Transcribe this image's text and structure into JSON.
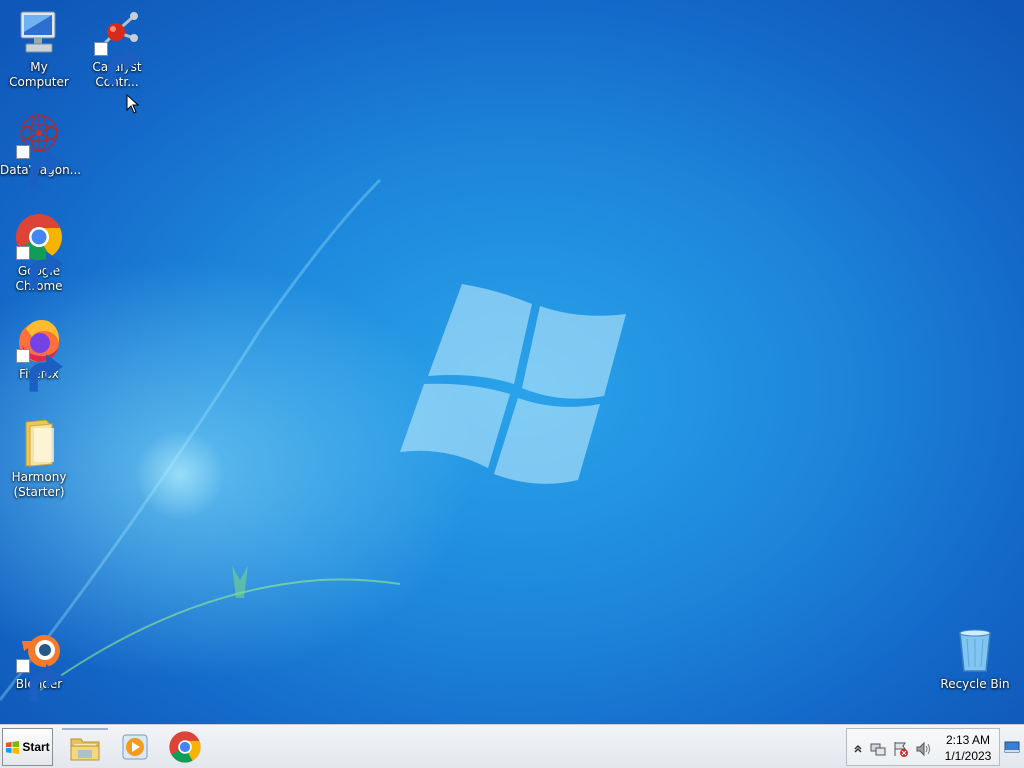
{
  "desktop": {
    "icons": [
      {
        "label": "My Computer",
        "icon": "computer-icon",
        "shortcut": false
      },
      {
        "label": "Catalyst Contr...",
        "icon": "catalyst-icon",
        "shortcut": true
      },
      {
        "label": "DataWagon...",
        "icon": "datawagon-icon",
        "shortcut": true
      },
      {
        "label": "Google Chrome",
        "icon": "chrome-icon",
        "shortcut": true
      },
      {
        "label": "Firefox",
        "icon": "firefox-icon",
        "shortcut": true
      },
      {
        "label": "Harmony (Starter)",
        "icon": "folder-icon",
        "shortcut": false
      },
      {
        "label": "Blender",
        "icon": "blender-icon",
        "shortcut": true
      },
      {
        "label": "Recycle Bin",
        "icon": "recycle-bin-icon",
        "shortcut": false
      }
    ]
  },
  "taskbar": {
    "start_label": "Start",
    "pinned": [
      {
        "name": "file-explorer",
        "icon": "folder-icon"
      },
      {
        "name": "media-player",
        "icon": "media-player-icon"
      },
      {
        "name": "google-chrome",
        "icon": "chrome-icon"
      }
    ],
    "tray": {
      "icons": [
        "show-hidden-icon",
        "network-icon",
        "action-center-icon",
        "volume-icon"
      ],
      "time": "2:13 AM",
      "date": "1/1/2023"
    }
  },
  "colors": {
    "wallpaper": "#1d86db",
    "taskbar": "#eceff2"
  }
}
